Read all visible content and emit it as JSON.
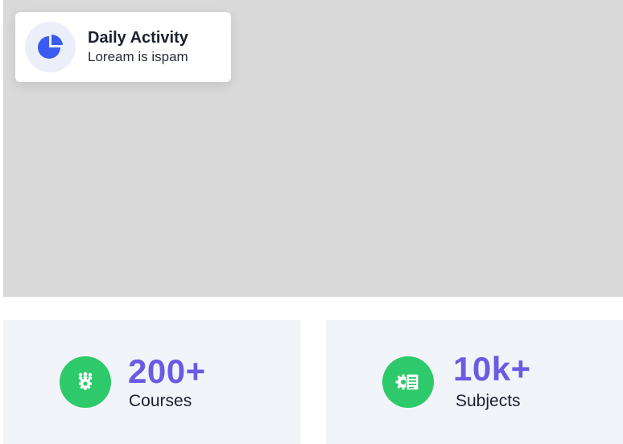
{
  "activity_card": {
    "title": "Daily Activity",
    "subtitle": "Loream is ispam",
    "icon": "pie-chart-icon"
  },
  "stats": [
    {
      "value": "200+",
      "label": "Courses",
      "icon": "group-gear-icon"
    },
    {
      "value": "10k+",
      "label": "Subjects",
      "icon": "document-gear-icon"
    }
  ],
  "colors": {
    "hero_bg": "#d9d9d9",
    "accent_blue": "#3b5bf0",
    "stat_number": "#6a5be2",
    "icon_green": "#2ec96b",
    "card_bg": "#f1f4f9"
  }
}
